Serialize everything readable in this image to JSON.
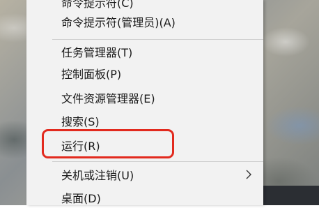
{
  "menu": {
    "items": [
      {
        "label": "命令提示符(C)"
      },
      {
        "label": "命令提示符(管理员)(A)"
      },
      {
        "label": "任务管理器(T)"
      },
      {
        "label": "控制面板(P)"
      },
      {
        "label": "文件资源管理器(E)"
      },
      {
        "label": "搜索(S)"
      },
      {
        "label": "运行(R)"
      },
      {
        "label": "关机或注销(U)"
      },
      {
        "label": "桌面(D)"
      }
    ]
  },
  "annotation": {
    "color": "#e22a1e"
  },
  "icons": {
    "submenu_arrow": "chevron-right-icon"
  }
}
